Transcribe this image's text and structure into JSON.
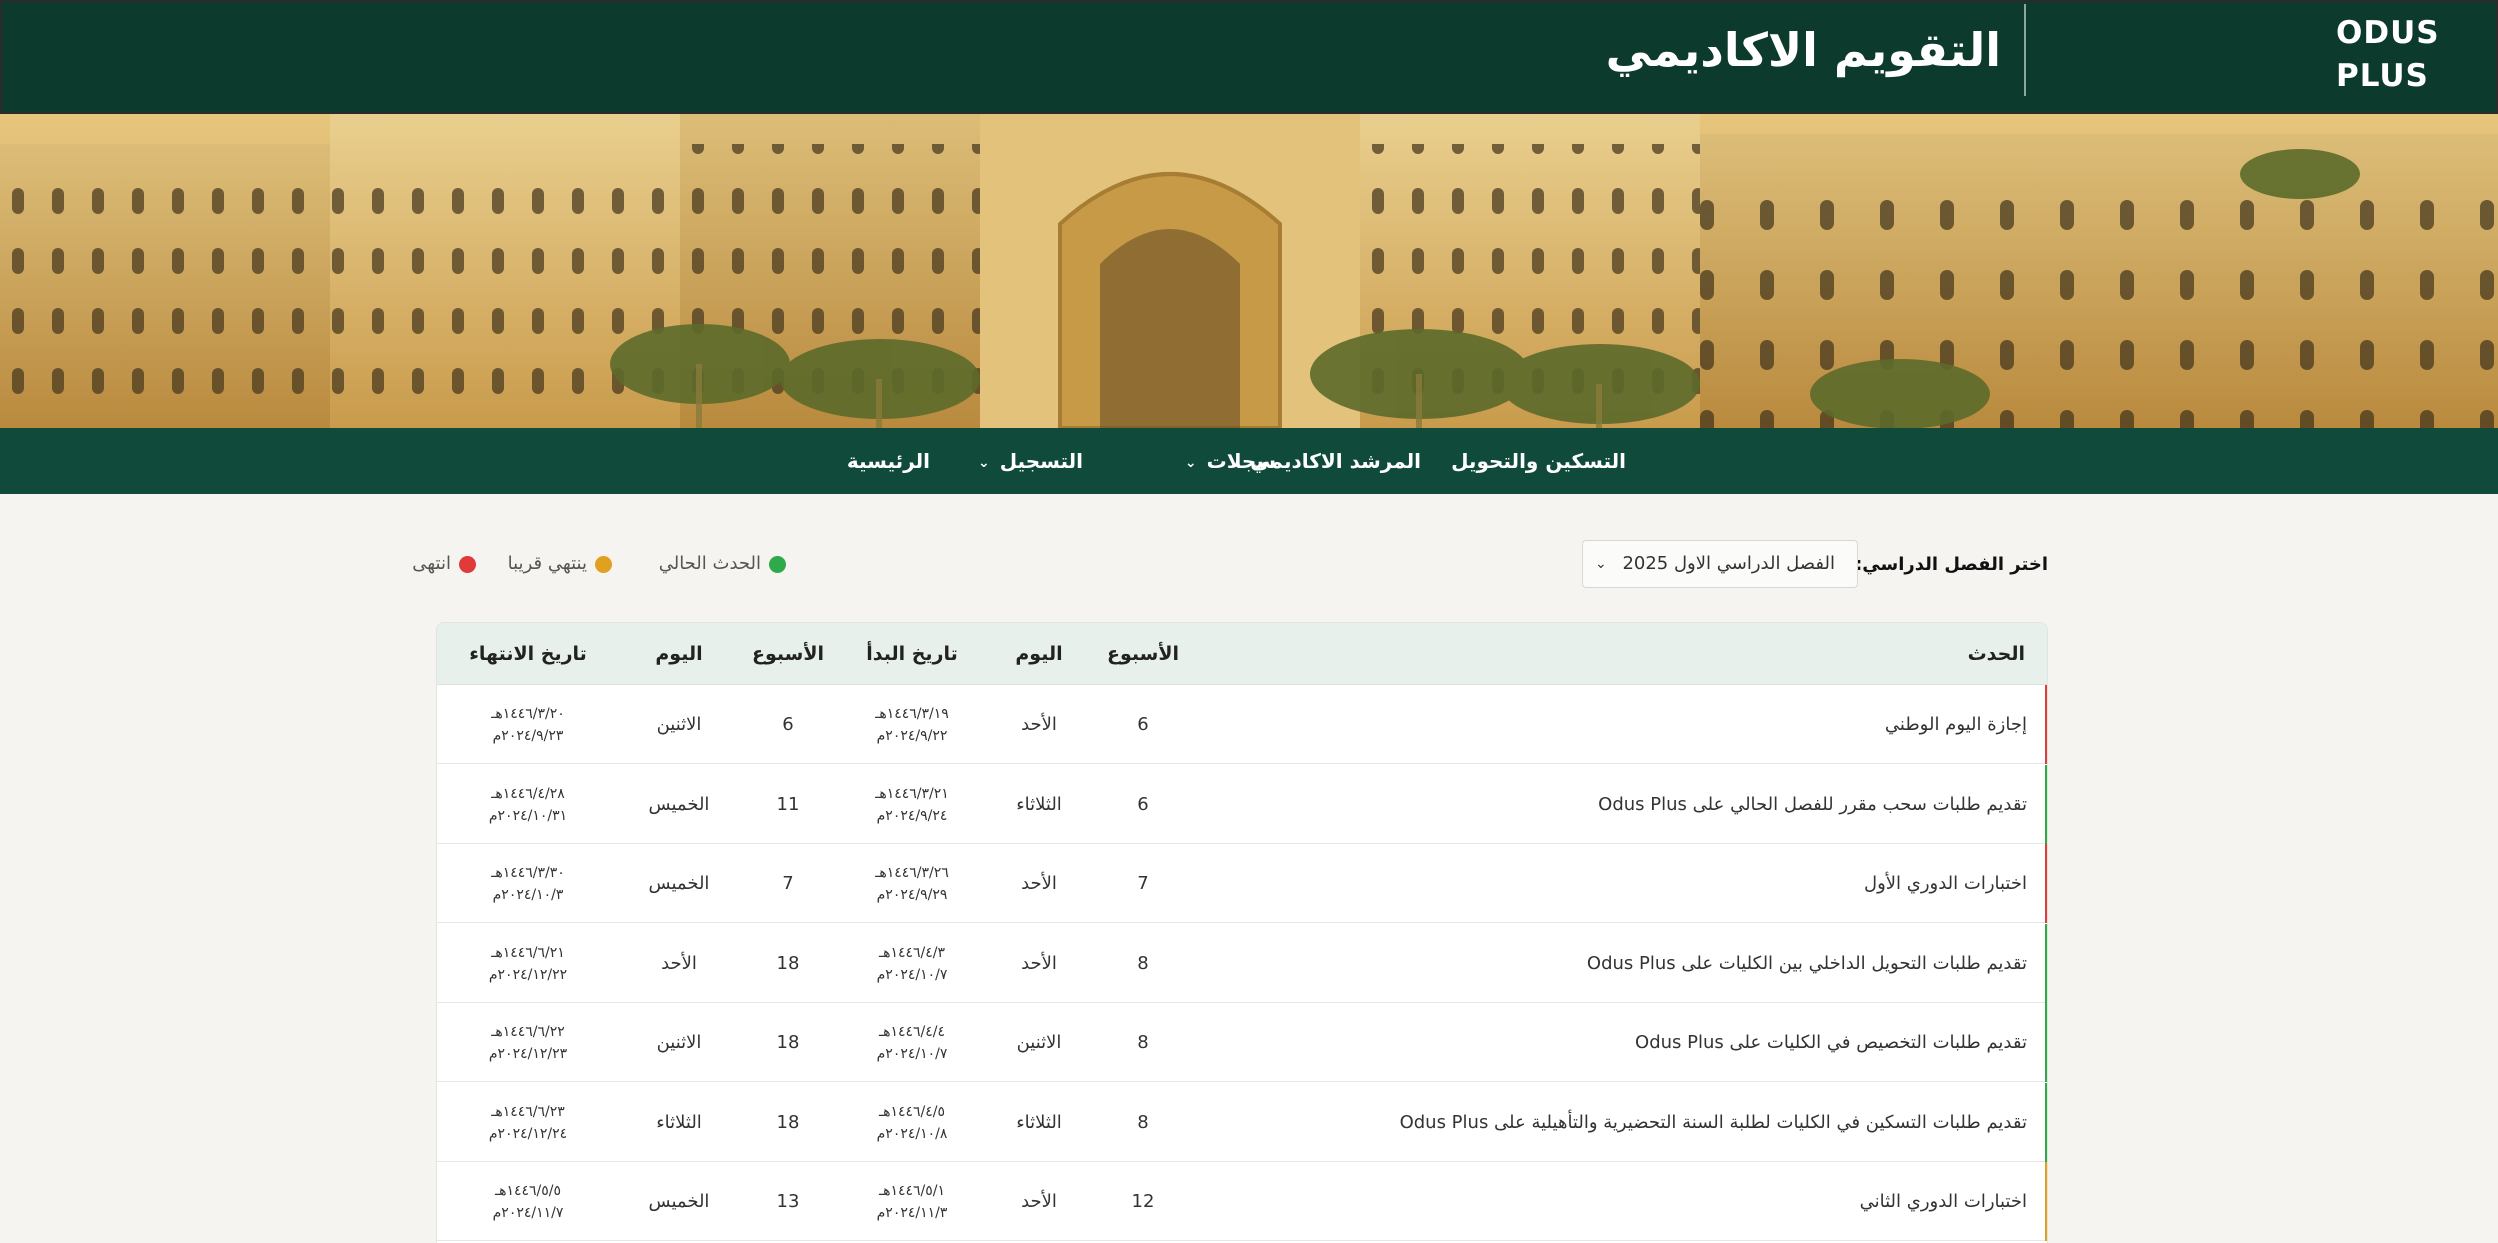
{
  "header": {
    "logo_line1": "ODUS",
    "logo_line2": "PLUS",
    "title": "التقويم الاكاديمي"
  },
  "nav": {
    "items": [
      {
        "label": "الرئيسية",
        "has_dropdown": false
      },
      {
        "label": "التسجيل",
        "has_dropdown": true
      },
      {
        "label": "سجلات",
        "has_dropdown": true
      },
      {
        "label": "المرشد الاكاديمي",
        "has_dropdown": false
      },
      {
        "label": "التسكين والتحويل",
        "has_dropdown": false
      }
    ]
  },
  "filters": {
    "semester_label": "اختر الفصل الدراسي:",
    "semester_value": "الفصل الدراسي الاول 2025"
  },
  "legend": {
    "current": {
      "label": "الحدث الحالي",
      "color": "#2eaa4a"
    },
    "ending_soon": {
      "label": "ينتهي قريبا",
      "color": "#e0a020"
    },
    "ended": {
      "label": "انتهى",
      "color": "#e03a3a"
    }
  },
  "table": {
    "headers": {
      "event": "الحدث",
      "week_start": "الأسبوع",
      "day_start": "اليوم",
      "start_date": "تاريخ البدأ",
      "week_end": "الأسبوع",
      "day_end": "اليوم",
      "end_date": "تاريخ الانتهاء"
    },
    "rows": [
      {
        "event": "إجازة اليوم الوطني",
        "status": "ended",
        "status_color": "#e03a3a",
        "week_start": "6",
        "day_start": "الأحد",
        "start_hijri": "١٤٤٦/٣/١٩هـ",
        "start_greg": "٢٠٢٤/٩/٢٢م",
        "week_end": "6",
        "day_end": "الاثنين",
        "end_hijri": "١٤٤٦/٣/٢٠هـ",
        "end_greg": "٢٠٢٤/٩/٢٣م"
      },
      {
        "event": "تقديم طلبات سحب مقرر للفصل الحالي على Odus Plus",
        "status": "current",
        "status_color": "#2eaa4a",
        "week_start": "6",
        "day_start": "الثلاثاء",
        "start_hijri": "١٤٤٦/٣/٢١هـ",
        "start_greg": "٢٠٢٤/٩/٢٤م",
        "week_end": "11",
        "day_end": "الخميس",
        "end_hijri": "١٤٤٦/٤/٢٨هـ",
        "end_greg": "٢٠٢٤/١٠/٣١م"
      },
      {
        "event": "اختبارات الدوري الأول",
        "status": "ended",
        "status_color": "#e03a3a",
        "week_start": "7",
        "day_start": "الأحد",
        "start_hijri": "١٤٤٦/٣/٢٦هـ",
        "start_greg": "٢٠٢٤/٩/٢٩م",
        "week_end": "7",
        "day_end": "الخميس",
        "end_hijri": "١٤٤٦/٣/٣٠هـ",
        "end_greg": "٢٠٢٤/١٠/٣م"
      },
      {
        "event": "تقديم طلبات التحويل الداخلي بين الكليات على Odus Plus",
        "status": "current",
        "status_color": "#2eaa4a",
        "week_start": "8",
        "day_start": "الأحد",
        "start_hijri": "١٤٤٦/٤/٣هـ",
        "start_greg": "٢٠٢٤/١٠/٧م",
        "week_end": "18",
        "day_end": "الأحد",
        "end_hijri": "١٤٤٦/٦/٢١هـ",
        "end_greg": "٢٠٢٤/١٢/٢٢م"
      },
      {
        "event": "تقديم طلبات التخصيص في الكليات على Odus Plus",
        "status": "current",
        "status_color": "#2eaa4a",
        "week_start": "8",
        "day_start": "الاثنين",
        "start_hijri": "١٤٤٦/٤/٤هـ",
        "start_greg": "٢٠٢٤/١٠/٧م",
        "week_end": "18",
        "day_end": "الاثنين",
        "end_hijri": "١٤٤٦/٦/٢٢هـ",
        "end_greg": "٢٠٢٤/١٢/٢٣م"
      },
      {
        "event": "تقديم طلبات التسكين في الكليات لطلبة السنة التحضيرية والتأهيلية على Odus Plus",
        "status": "current",
        "status_color": "#2eaa4a",
        "week_start": "8",
        "day_start": "الثلاثاء",
        "start_hijri": "١٤٤٦/٤/٥هـ",
        "start_greg": "٢٠٢٤/١٠/٨م",
        "week_end": "18",
        "day_end": "الثلاثاء",
        "end_hijri": "١٤٤٦/٦/٢٣هـ",
        "end_greg": "٢٠٢٤/١٢/٢٤م"
      },
      {
        "event": "اختبارات الدوري الثاني",
        "status": "ending_soon",
        "status_color": "#e0a020",
        "week_start": "12",
        "day_start": "الأحد",
        "start_hijri": "١٤٤٦/٥/١هـ",
        "start_greg": "٢٠٢٤/١١/٣م",
        "week_end": "13",
        "day_end": "الخميس",
        "end_hijri": "١٤٤٦/٥/٥هـ",
        "end_greg": "٢٠٢٤/١١/٧م"
      }
    ]
  }
}
